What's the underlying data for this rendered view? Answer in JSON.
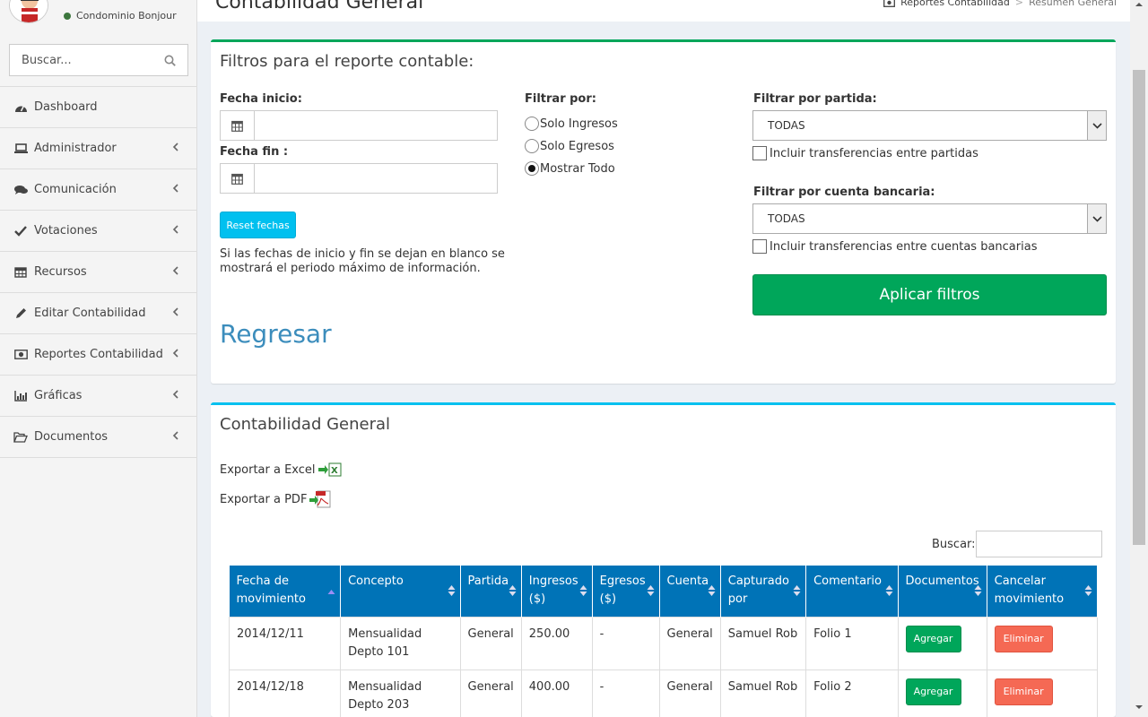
{
  "user": {
    "name": "Condominio Bonjour"
  },
  "sidebar": {
    "search_placeholder": "Buscar...",
    "items": [
      {
        "label": "Dashboard",
        "icon": "dashboard-icon"
      },
      {
        "label": "Administrador",
        "icon": "laptop-icon"
      },
      {
        "label": "Comunicación",
        "icon": "comments-icon"
      },
      {
        "label": "Votaciones",
        "icon": "check-icon"
      },
      {
        "label": "Recursos",
        "icon": "calendar-icon"
      },
      {
        "label": "Editar Contabilidad",
        "icon": "pencil-icon"
      },
      {
        "label": "Reportes Contabilidad",
        "icon": "money-icon"
      },
      {
        "label": "Gráficas",
        "icon": "bar-chart-icon"
      },
      {
        "label": "Documentos",
        "icon": "folder-open-icon"
      }
    ]
  },
  "header": {
    "title": "Contabilidad General",
    "breadcrumb": [
      "Reportes Contabilidad",
      "Resumen General"
    ]
  },
  "filters": {
    "title": "Filtros para el reporte contable:",
    "fecha_inicio_label": "Fecha inicio:",
    "fecha_fin_label": "Fecha fin :",
    "fecha_inicio_value": "",
    "fecha_fin_value": "",
    "reset_label": "Reset fechas",
    "help_text_line1": "Si las fechas de inicio y fin se dejan en blanco se",
    "help_text_line2": "mostrará el periodo máximo de información.",
    "filtrar_por_label": "Filtrar por:",
    "radio_options": [
      "Solo Ingresos",
      "Solo Egresos",
      "Mostrar Todo"
    ],
    "radio_selected": "Mostrar Todo",
    "partida_label": "Filtrar por partida:",
    "partida_value": "TODAS",
    "partida_checkbox": "Incluir transferencias entre partidas",
    "cuenta_label": "Filtrar por cuenta bancaria:",
    "cuenta_value": "TODAS",
    "cuenta_checkbox": "Incluir transferencias entre cuentas bancarias",
    "apply_label": "Aplicar filtros",
    "back_label": "Regresar"
  },
  "report": {
    "title": "Contabilidad General",
    "export_excel": "Exportar a Excel",
    "export_pdf": "Exportar a PDF",
    "search_label": "Buscar:",
    "search_value": "",
    "columns": [
      "Fecha de movimiento",
      "Concepto",
      "Partida",
      "Ingresos ($)",
      "Egresos ($)",
      "Cuenta",
      "Capturado por",
      "Comentario",
      "Documentos",
      "Cancelar movimiento"
    ],
    "add_label": "Agregar",
    "delete_label": "Eliminar",
    "rows": [
      {
        "fecha": "2014/12/11",
        "concepto": "Mensualidad Depto 101",
        "partida": "General",
        "ingresos": "250.00",
        "egresos": "-",
        "cuenta": "General",
        "capturado": "Samuel Rob",
        "comentario": "Folio 1"
      },
      {
        "fecha": "2014/12/18",
        "concepto": "Mensualidad Depto 203",
        "partida": "General",
        "ingresos": "400.00",
        "egresos": "-",
        "cuenta": "General",
        "capturado": "Samuel Rob",
        "comentario": "Folio 2"
      }
    ]
  },
  "colors": {
    "green": "#00a65a",
    "aqua": "#00c0ef",
    "blue": "#0073b7",
    "red": "#f56954",
    "link": "#3c8dbc"
  }
}
